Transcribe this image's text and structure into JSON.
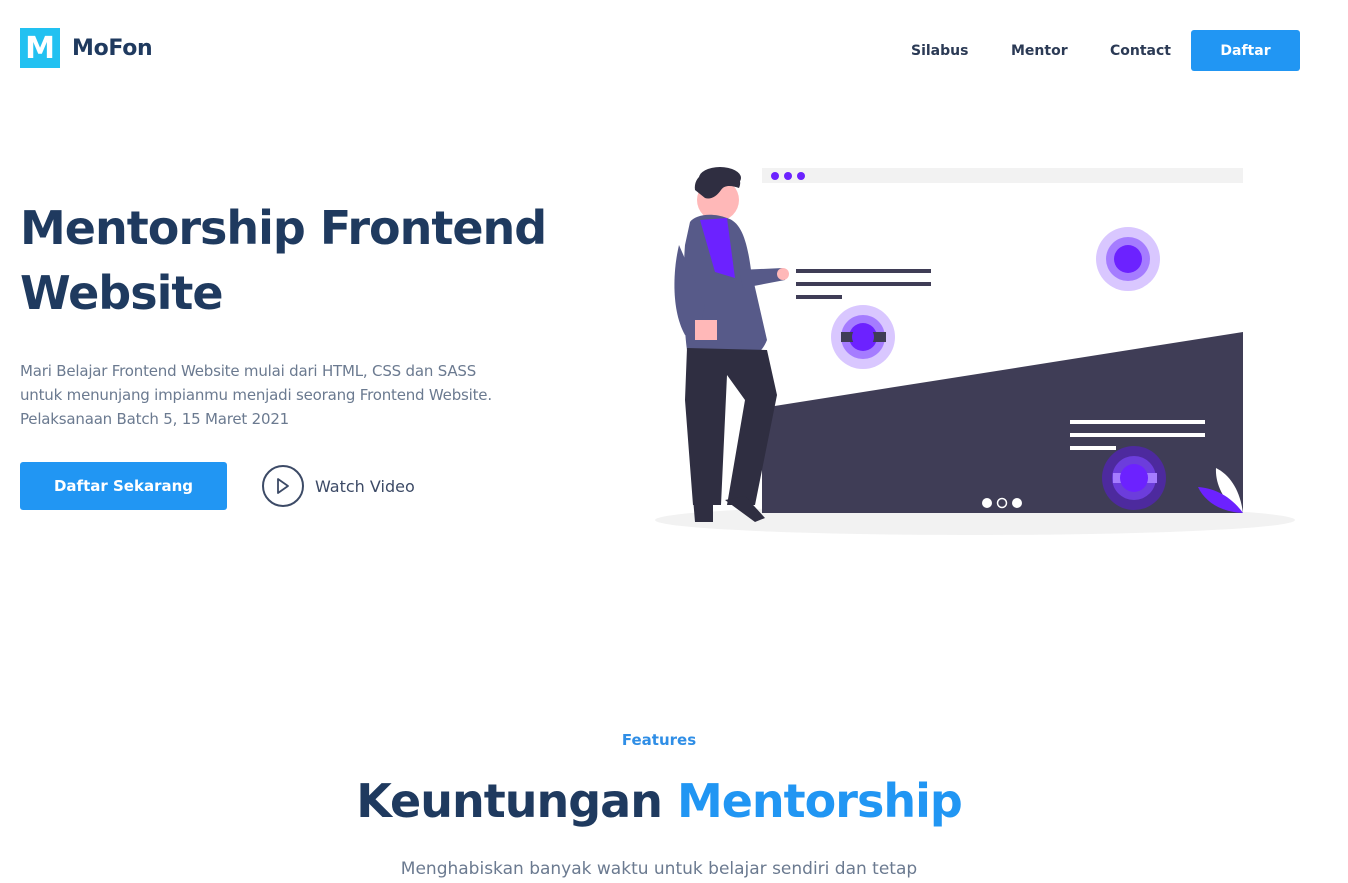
{
  "navbar": {
    "logo_letter": "M",
    "brand": "MoFon",
    "links": [
      "Silabus",
      "Mentor",
      "Contact"
    ],
    "cta": "Daftar"
  },
  "hero": {
    "title_line1": "Mentorship Frontend",
    "title_line2": "Website",
    "description_lines": [
      "Mari Belajar Frontend Website mulai dari HTML, CSS dan SASS",
      "untuk menunjang impianmu menjadi seorang Frontend Website.",
      "Pelaksanaan Batch 5, 15 Maret 2021"
    ],
    "primary_button": "Daftar Sekarang",
    "watch_video": "Watch Video"
  },
  "features": {
    "eyebrow": "Features",
    "title_main": "Keuntungan",
    "title_accent": "Mentorship",
    "subtitle": "Menghabiskan banyak waktu untuk belajar sendiri dan tetap"
  },
  "colors": {
    "primary": "#2196f3",
    "heading": "#1f3a5f",
    "logo": "#22c1f1",
    "illustration_accent": "#6c22ff",
    "illustration_dark": "#3f3d56"
  }
}
